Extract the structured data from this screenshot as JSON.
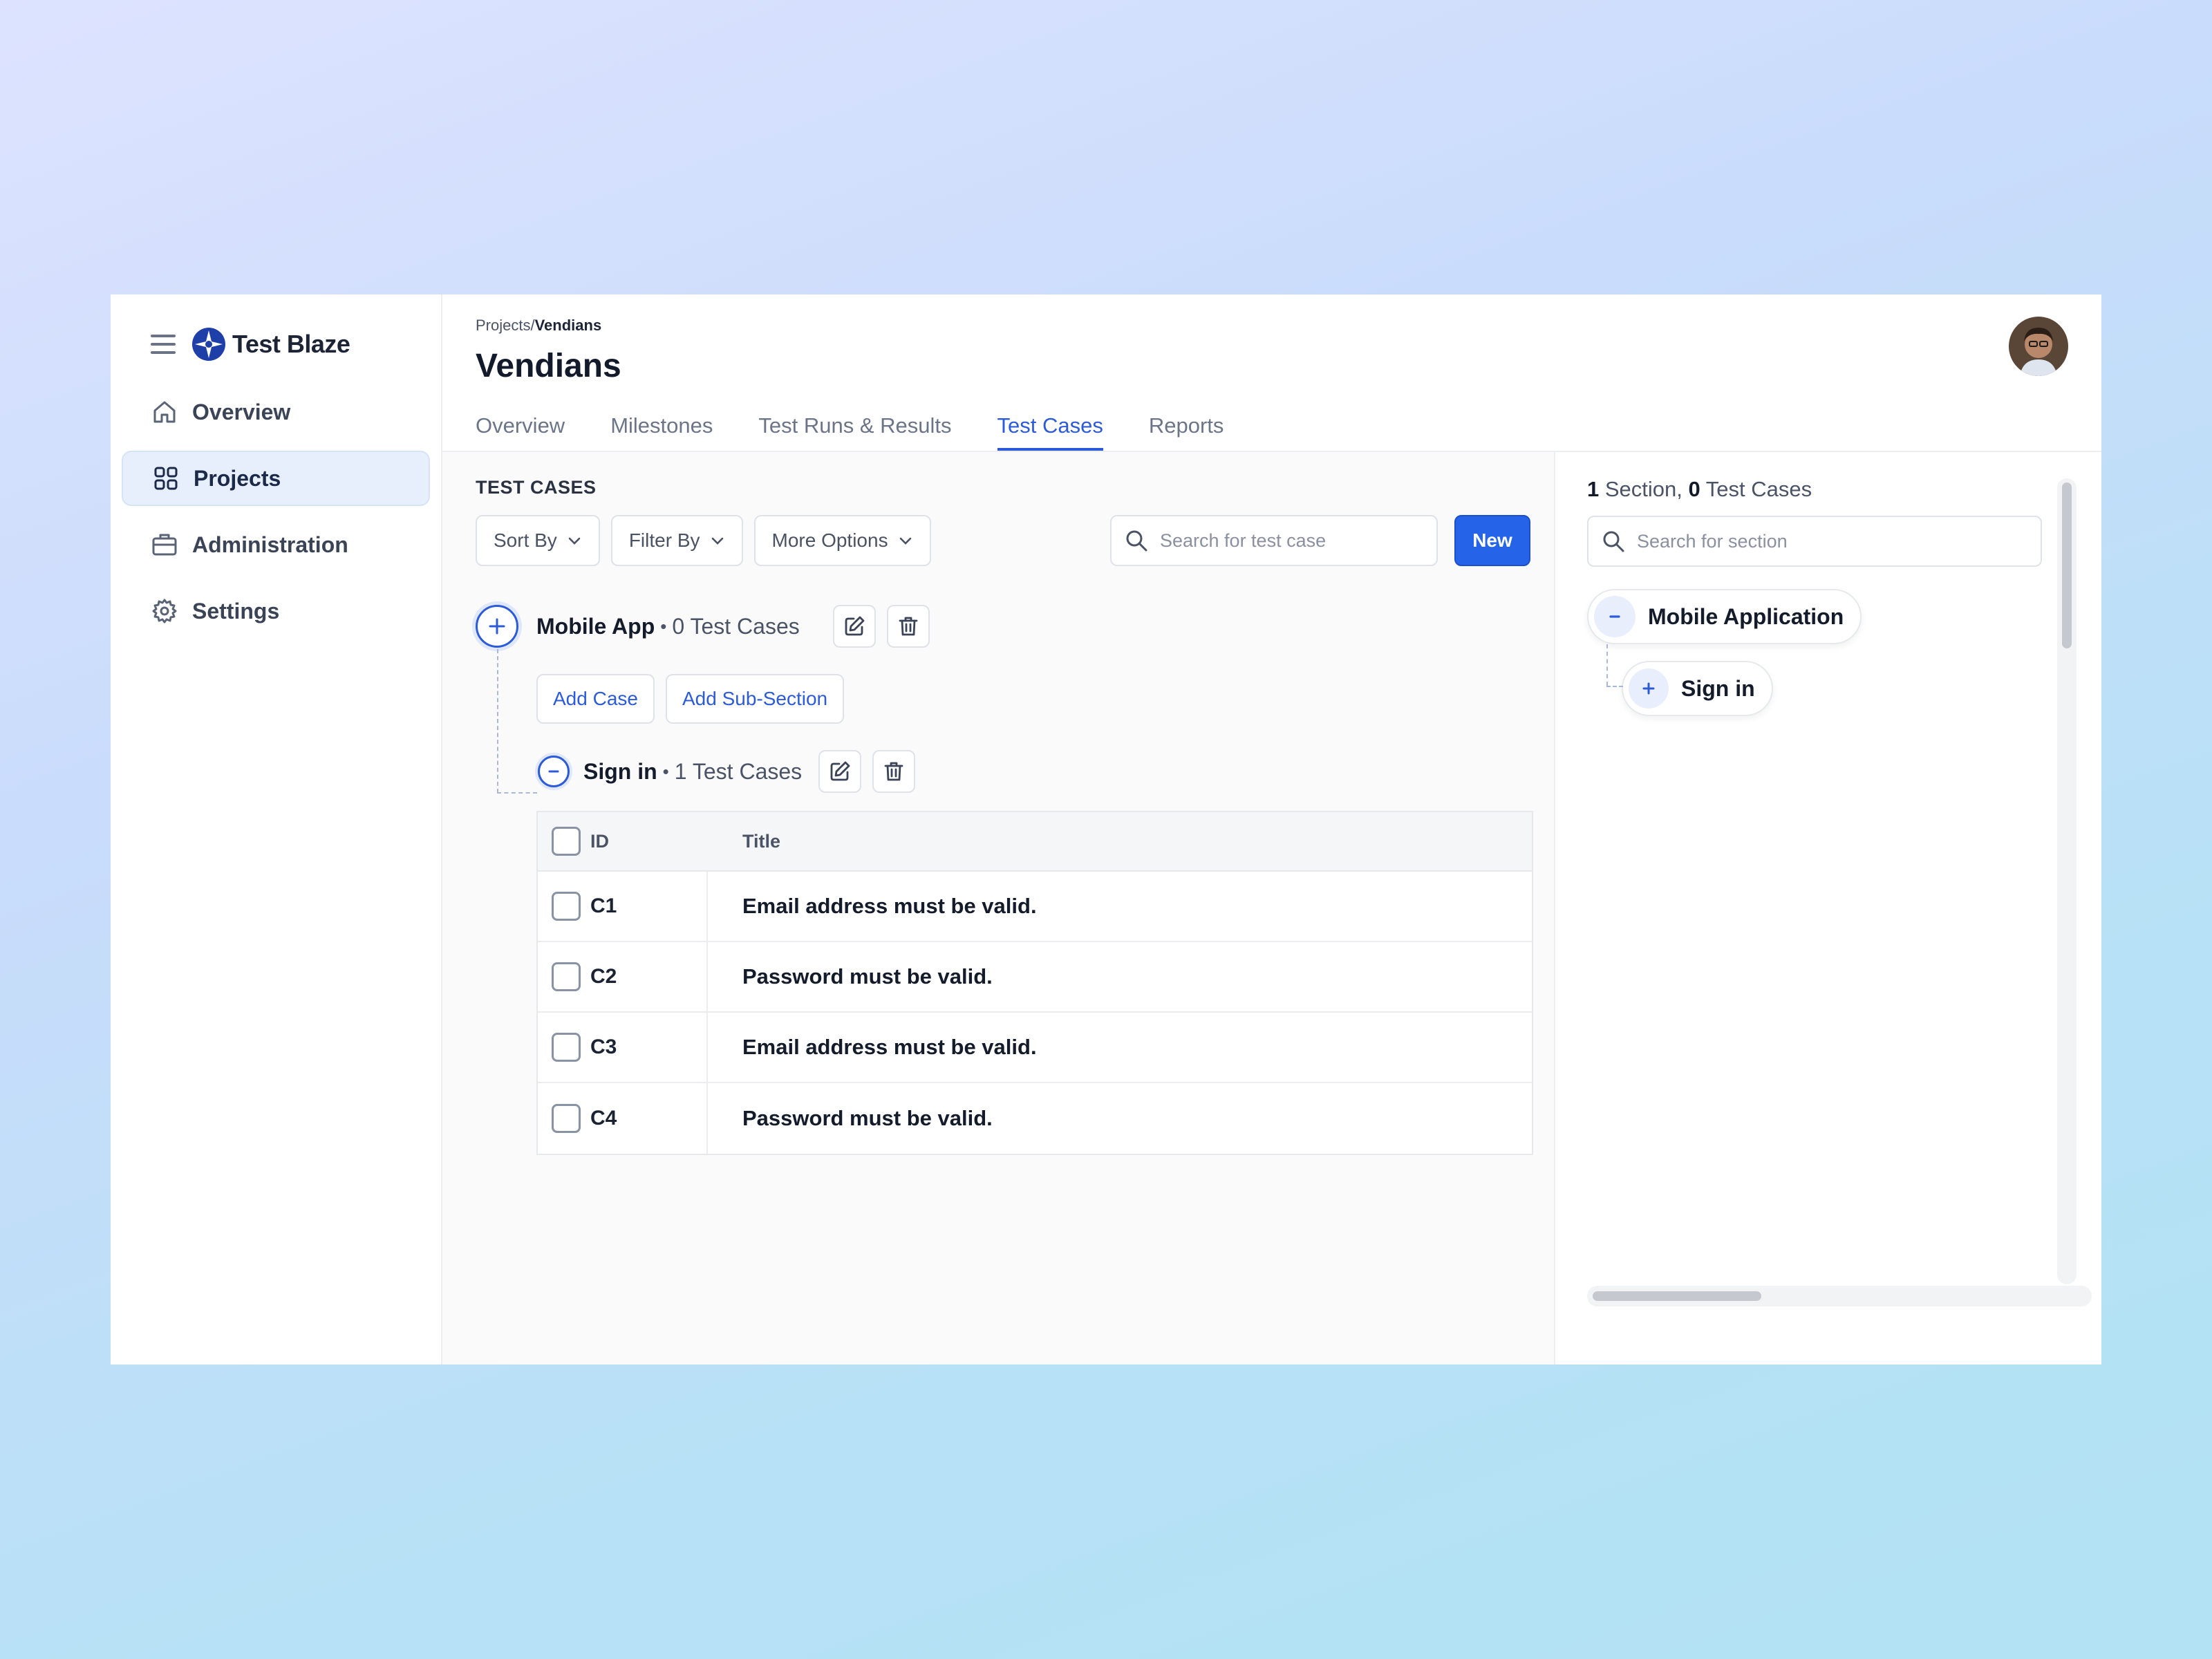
{
  "app": {
    "brand_name": "Test Blaze",
    "accent_color": "#2d5bd8"
  },
  "sidebar": {
    "items": [
      {
        "label": "Overview",
        "icon": "home-icon",
        "active": false
      },
      {
        "label": "Projects",
        "icon": "grid-icon",
        "active": true
      },
      {
        "label": "Administration",
        "icon": "briefcase-icon",
        "active": false
      },
      {
        "label": "Settings",
        "icon": "gear-icon",
        "active": false
      }
    ]
  },
  "header": {
    "breadcrumb_root": "Projects/",
    "breadcrumb_current": "Vendians",
    "title": "Vendians",
    "tabs": [
      {
        "label": "Overview",
        "active": false
      },
      {
        "label": "Milestones",
        "active": false
      },
      {
        "label": "Test Runs & Results",
        "active": false
      },
      {
        "label": "Test Cases",
        "active": true
      },
      {
        "label": "Reports",
        "active": false
      }
    ]
  },
  "cases": {
    "heading": "TEST CASES",
    "sort_label": "Sort By",
    "filter_label": "Filter By",
    "more_label": "More Options",
    "search_placeholder": "Search for test case",
    "new_label": "New",
    "section": {
      "name": "Mobile App",
      "bullet": "•",
      "count": "0 Test Cases",
      "add_case_label": "Add Case",
      "add_subsection_label": "Add Sub-Section",
      "subsection": {
        "name": "Sign in",
        "bullet": "•",
        "count": "1 Test Cases"
      }
    },
    "table": {
      "col_id": "ID",
      "col_title": "Title",
      "rows": [
        {
          "id": "C1",
          "title": "Email address must be valid."
        },
        {
          "id": "C2",
          "title": "Password must be valid."
        },
        {
          "id": "C3",
          "title": "Email address must be valid."
        },
        {
          "id": "C4",
          "title": "Password must be valid."
        }
      ]
    }
  },
  "sections_panel": {
    "section_count": "1",
    "section_word": " Section, ",
    "case_count": "0",
    "case_word": " Test Cases",
    "search_placeholder": "Search for section",
    "root_label": "Mobile Application",
    "child_label": "Sign in"
  }
}
